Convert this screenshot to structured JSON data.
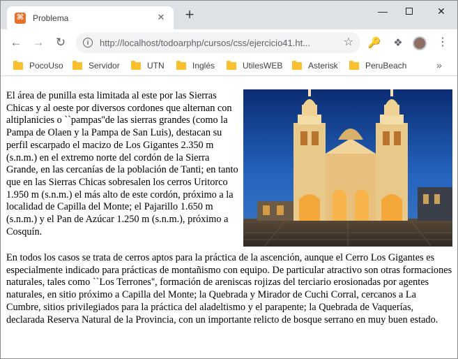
{
  "browser": {
    "tab_title": "Problema",
    "favicon_glyph": "⌘",
    "url": "http://localhost/todoarphp/cursos/css/ejercicio41.ht...",
    "accent_color": "#e8702a"
  },
  "bookmarks": [
    {
      "label": "PocoUso"
    },
    {
      "label": "Servidor"
    },
    {
      "label": "UTN"
    },
    {
      "label": "Inglés"
    },
    {
      "label": "UtilesWEB"
    },
    {
      "label": "Asterisk"
    },
    {
      "label": "PeruBeach"
    }
  ],
  "page": {
    "paragraph1": "El área de punilla esta limitada al este por las Sierras Chicas y al oeste por diversos cordones que alternan con altiplanicies o ``pampas''de las sierras grandes (como la Pampa de Olaen y la Pampa de San Luis), destacan su perfil escarpado el macizo de Los Gigantes 2.350 m (s.n.m.) en el extremo norte del cordón de la Sierra Grande, en las cercanías de la población de Tanti; en tanto que en las Sierras Chicas sobresalen los cerros Uritorco 1.950 m (s.n.m.) el más alto de este cordón, próximo a la localidad de Capilla del Monte; el Pajarillo 1.650 m (s.n.m.) y el Pan de Azúcar 1.250 m (s.n.m.), próximo a Cosquín.",
    "paragraph2": "En todos los casos se trata de cerros aptos para la práctica de la ascención, aunque el Cerro Los Gigantes es especialmente indicado para prácticas de montañismo con equipo. De particular atractivo son otras formaciones naturales, tales como ``Los Terrones'', formación de areniscas rojizas del terciario erosionadas por agentes naturales, en sitio próximo a Capilla del Monte; la Quebrada y Mirador de Cuchi Corral, cercanos a La Cumbre, sitios privilegiados para la práctica del aladeltismo y el parapente; la Quebrada de Vaquerías, declarada Reserva Natural de la Provincia, con un importante relicto de bosque serrano en muy buen estado."
  }
}
